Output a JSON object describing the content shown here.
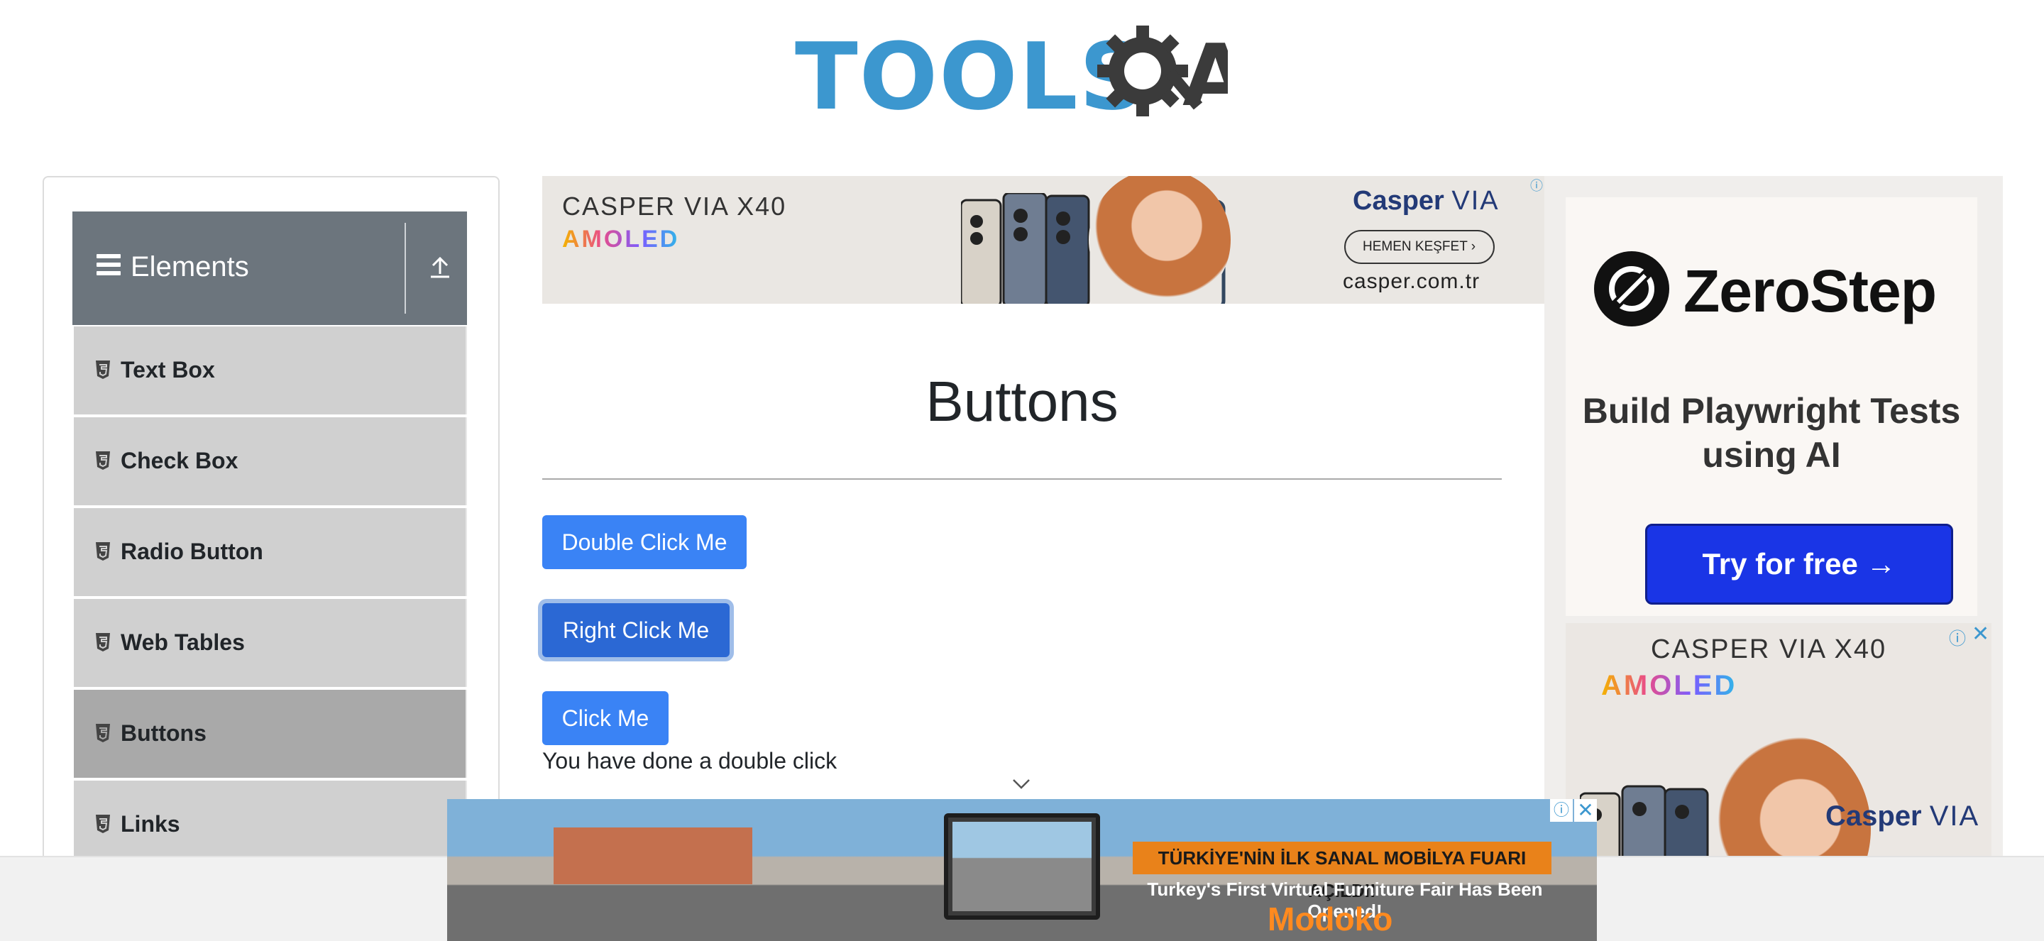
{
  "header": {
    "logo_tools": "TOOLS",
    "logo_qa": "A"
  },
  "sidebar": {
    "group_title": "Elements",
    "items": [
      {
        "label": "Text Box",
        "active": false
      },
      {
        "label": "Check Box",
        "active": false
      },
      {
        "label": "Radio Button",
        "active": false
      },
      {
        "label": "Web Tables",
        "active": false
      },
      {
        "label": "Buttons",
        "active": true
      },
      {
        "label": "Links",
        "active": false
      }
    ]
  },
  "ad_top": {
    "brand_line": "CASPER VIA X40",
    "amoled": "AMOLED",
    "brand_logo": "Casper",
    "brand_logo_suffix": "VIA",
    "cta": "HEMEN KEŞFET",
    "domain": "casper.com.tr"
  },
  "main": {
    "title": "Buttons",
    "double_click_button": "Double Click Me",
    "right_click_button": "Right Click Me",
    "click_button": "Click Me",
    "result_message": "You have done a double click"
  },
  "ad_right": {
    "zerostep_brand": "ZeroStep",
    "zerostep_tagline": "Build Playwright Tests using AI",
    "zerostep_cta": "Try for free →",
    "casper_brand_line": "CASPER VIA X40",
    "casper_amoled": "AMOLED",
    "casper_logo": "Casper",
    "casper_logo_suffix": "VIA"
  },
  "ad_bottom": {
    "ribbon": "TÜRKİYE'NİN İLK SANAL MOBİLYA FUARI AÇILDI!",
    "subline": "Turkey's First Virtual Furniture Fair Has Been Opened!",
    "brand": "Modoko"
  },
  "colors": {
    "primary_button": "#3a83f5",
    "sidebar_header": "#6c757d",
    "menu_item": "#d0d0d0",
    "menu_item_active": "#a9a9a9",
    "logo_blue": "#3c97cf"
  }
}
